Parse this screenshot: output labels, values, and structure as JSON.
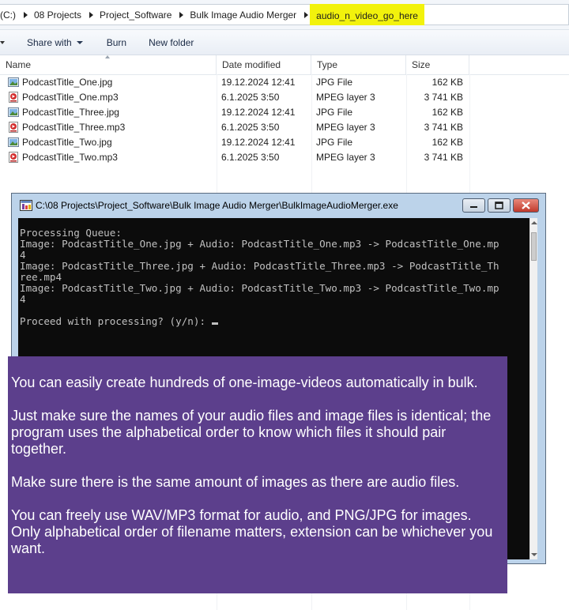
{
  "address": {
    "drive": "(C:)",
    "crumbs": [
      "08 Projects",
      "Project_Software",
      "Bulk Image Audio Merger"
    ],
    "current": "audio_n_video_go_here",
    "highlight": "#f2f20c"
  },
  "toolbar": {
    "share_with": "Share with",
    "burn": "Burn",
    "new_folder": "New folder"
  },
  "columns": {
    "name": "Name",
    "date": "Date modified",
    "type": "Type",
    "size": "Size"
  },
  "files": [
    {
      "name": "PodcastTitle_One.jpg",
      "date": "19.12.2024 12:41",
      "type": "JPG File",
      "size": "162 KB",
      "icon": "image-file-icon"
    },
    {
      "name": "PodcastTitle_One.mp3",
      "date": "6.1.2025 3:50",
      "type": "MPEG layer 3",
      "size": "3 741 KB",
      "icon": "audio-file-icon"
    },
    {
      "name": "PodcastTitle_Three.jpg",
      "date": "19.12.2024 12:41",
      "type": "JPG File",
      "size": "162 KB",
      "icon": "image-file-icon"
    },
    {
      "name": "PodcastTitle_Three.mp3",
      "date": "6.1.2025 3:50",
      "type": "MPEG layer 3",
      "size": "3 741 KB",
      "icon": "audio-file-icon"
    },
    {
      "name": "PodcastTitle_Two.jpg",
      "date": "19.12.2024 12:41",
      "type": "JPG File",
      "size": "162 KB",
      "icon": "image-file-icon"
    },
    {
      "name": "PodcastTitle_Two.mp3",
      "date": "6.1.2025 3:50",
      "type": "MPEG layer 3",
      "size": "3 741 KB",
      "icon": "audio-file-icon"
    }
  ],
  "console": {
    "title": "C:\\08 Projects\\Project_Software\\Bulk Image Audio Merger\\BulkImageAudioMerger.exe",
    "lines": [
      "Processing Queue:",
      "Image: PodcastTitle_One.jpg + Audio: PodcastTitle_One.mp3 -> PodcastTitle_One.mp",
      "4",
      "Image: PodcastTitle_Three.jpg + Audio: PodcastTitle_Three.mp3 -> PodcastTitle_Th",
      "ree.mp4",
      "Image: PodcastTitle_Two.jpg + Audio: PodcastTitle_Two.mp3 -> PodcastTitle_Two.mp",
      "4",
      "",
      "Proceed with processing? (y/n): "
    ]
  },
  "note": {
    "background": "#5c3f8c",
    "paragraphs": [
      "You can easily create hundreds of one-image-videos automatically in bulk.",
      "Just make sure the names of your audio files and image files is identical; the program uses the alphabetical order to know which files it should pair together.",
      "Make sure there is the same amount of images as there are audio files.",
      "You can freely use WAV/MP3 format for audio, and PNG/JPG for images. Only alphabetical order of filename matters, extension can be whichever you want."
    ]
  }
}
